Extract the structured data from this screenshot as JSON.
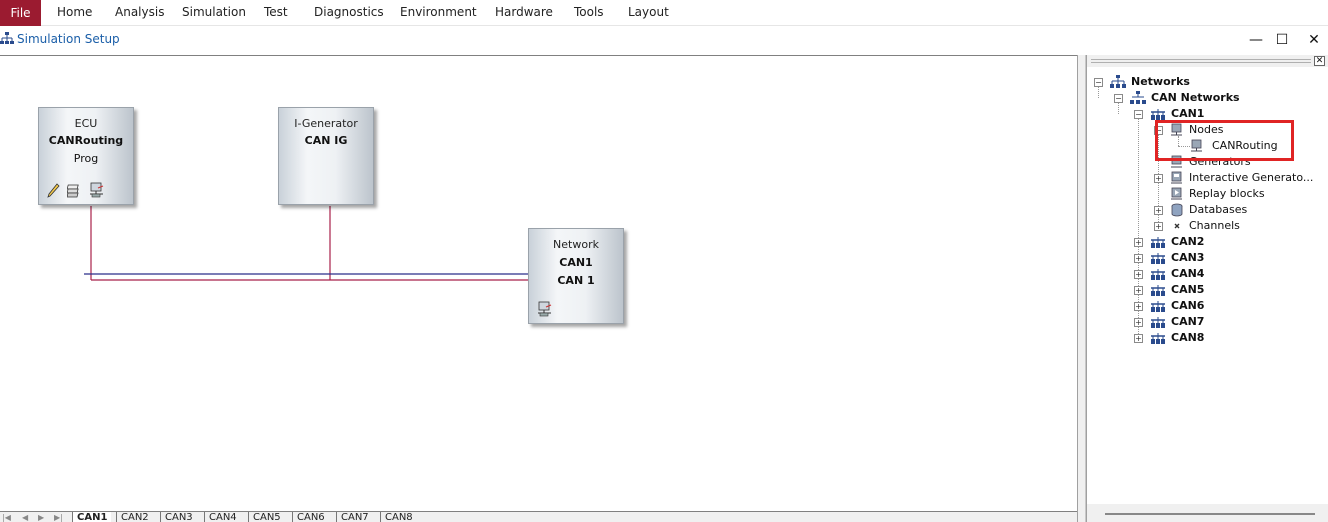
{
  "menu": {
    "file": "File",
    "items": [
      "Home",
      "Analysis",
      "Simulation",
      "Test",
      "Diagnostics",
      "Environment",
      "Hardware",
      "Tools",
      "Layout"
    ]
  },
  "window": {
    "title": "Simulation Setup",
    "minimize": "—",
    "maximize": "☐",
    "close": "✕"
  },
  "blocks": {
    "ecu": {
      "line1": "ECU",
      "line2": "CANRouting",
      "line3": "Prog"
    },
    "generator": {
      "line1": "I-Generator",
      "line2": "CAN IG"
    },
    "network": {
      "line1": "Network",
      "line2": "CAN1",
      "line3": "CAN 1"
    }
  },
  "colors": {
    "file_menu": "#9b1b30",
    "title_text": "#1a5ea8",
    "bus_blue": "#2b2f8a",
    "bus_red": "#a8204a",
    "highlight": "#e02424"
  },
  "tabs": [
    "CAN1",
    "CAN2",
    "CAN3",
    "CAN4",
    "CAN5",
    "CAN6",
    "CAN7",
    "CAN8"
  ],
  "active_tab": "CAN1",
  "tree": {
    "root": "Networks",
    "can_networks": "CAN Networks",
    "can1": "CAN1",
    "nodes": "Nodes",
    "node_item": "CANRouting",
    "generators": "Generators",
    "interactive_generators": "Interactive Generato...",
    "replay_blocks": "Replay blocks",
    "databases": "Databases",
    "channels": "Channels",
    "other_networks": [
      "CAN2",
      "CAN3",
      "CAN4",
      "CAN5",
      "CAN6",
      "CAN7",
      "CAN8"
    ]
  }
}
